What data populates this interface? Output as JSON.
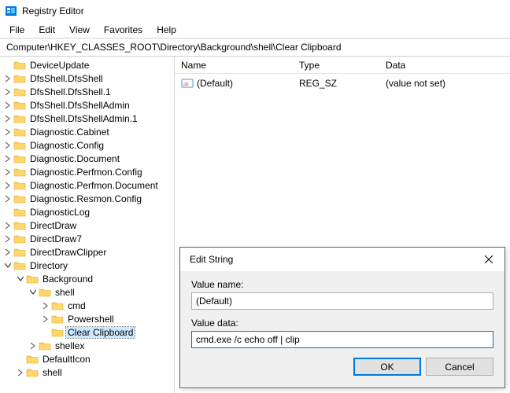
{
  "window": {
    "title": "Registry Editor"
  },
  "menu": {
    "file": "File",
    "edit": "Edit",
    "view": "View",
    "favorites": "Favorites",
    "help": "Help"
  },
  "address": {
    "path": "Computer\\HKEY_CLASSES_ROOT\\Directory\\Background\\shell\\Clear Clipboard"
  },
  "tree": [
    {
      "depth": 1,
      "arrow": "none",
      "label": "DeviceUpdate"
    },
    {
      "depth": 1,
      "arrow": "right",
      "label": "DfsShell.DfsShell"
    },
    {
      "depth": 1,
      "arrow": "right",
      "label": "DfsShell.DfsShell.1"
    },
    {
      "depth": 1,
      "arrow": "right",
      "label": "DfsShell.DfsShellAdmin"
    },
    {
      "depth": 1,
      "arrow": "right",
      "label": "DfsShell.DfsShellAdmin.1"
    },
    {
      "depth": 1,
      "arrow": "right",
      "label": "Diagnostic.Cabinet"
    },
    {
      "depth": 1,
      "arrow": "right",
      "label": "Diagnostic.Config"
    },
    {
      "depth": 1,
      "arrow": "right",
      "label": "Diagnostic.Document"
    },
    {
      "depth": 1,
      "arrow": "right",
      "label": "Diagnostic.Perfmon.Config"
    },
    {
      "depth": 1,
      "arrow": "right",
      "label": "Diagnostic.Perfmon.Document"
    },
    {
      "depth": 1,
      "arrow": "right",
      "label": "Diagnostic.Resmon.Config"
    },
    {
      "depth": 1,
      "arrow": "none",
      "label": "DiagnosticLog"
    },
    {
      "depth": 1,
      "arrow": "right",
      "label": "DirectDraw"
    },
    {
      "depth": 1,
      "arrow": "right",
      "label": "DirectDraw7"
    },
    {
      "depth": 1,
      "arrow": "right",
      "label": "DirectDrawClipper"
    },
    {
      "depth": 1,
      "arrow": "down",
      "label": "Directory"
    },
    {
      "depth": 2,
      "arrow": "down",
      "label": "Background"
    },
    {
      "depth": 3,
      "arrow": "down",
      "label": "shell"
    },
    {
      "depth": 4,
      "arrow": "right",
      "label": "cmd"
    },
    {
      "depth": 4,
      "arrow": "right",
      "label": "Powershell"
    },
    {
      "depth": 4,
      "arrow": "none",
      "label": "Clear Clipboard",
      "selected": true
    },
    {
      "depth": 3,
      "arrow": "right",
      "label": "shellex"
    },
    {
      "depth": 2,
      "arrow": "none",
      "label": "DefaultIcon"
    },
    {
      "depth": 2,
      "arrow": "right",
      "label": "shell"
    }
  ],
  "list": {
    "columns": {
      "name": "Name",
      "type": "Type",
      "data": "Data"
    },
    "rows": [
      {
        "name": "(Default)",
        "type": "REG_SZ",
        "data": "(value not set)"
      }
    ]
  },
  "dialog": {
    "title": "Edit String",
    "name_label": "Value name:",
    "name_value": "(Default)",
    "data_label": "Value data:",
    "data_value": "cmd.exe /c echo off | clip",
    "ok": "OK",
    "cancel": "Cancel"
  }
}
